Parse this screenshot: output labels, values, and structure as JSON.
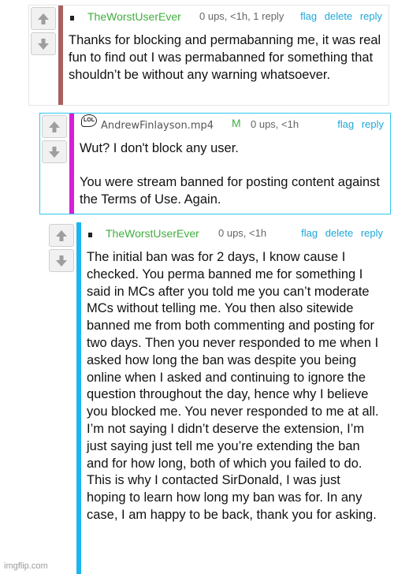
{
  "colors": {
    "bar_c1": "#a86060",
    "bar_c2": "#d81ed8",
    "bar_c3": "#1ab7ee",
    "border_c2": "#2ec7f0",
    "action": "#1ea7d6",
    "username": "#3fae3f"
  },
  "comments": [
    {
      "username": "TheWorstUserEver",
      "meta": "0 ups, <1h, 1 reply",
      "actions": [
        "flag",
        "delete",
        "reply"
      ],
      "text": [
        "Thanks for blocking and permabanning me, it was real fun to find out I was permabanned for something that shouldn’t be without any warning whatsoever."
      ]
    },
    {
      "avatar_text": "LOL",
      "username": "AndrewFinlayson.mp4",
      "badge": "M",
      "meta": "0 ups, <1h",
      "actions": [
        "flag",
        "reply"
      ],
      "text": [
        "Wut? I don't block any user.",
        "You were stream banned for posting content against the Terms of Use. Again."
      ]
    },
    {
      "username": "TheWorstUserEver",
      "meta": "0 ups, <1h",
      "actions": [
        "flag",
        "delete",
        "reply"
      ],
      "text": [
        "The initial ban was for 2 days, I know cause I checked. You perma banned me for something I said in MCs after you told me you can’t moderate MCs without telling me. You then also sitewide banned me from both commenting and posting for two days. Then you never responded to me when I asked how long the ban was despite you being online when I asked and continuing to ignore the question throughout the day, hence why I believe you blocked me. You never responded to me at all. I’m not saying I didn’t deserve the extension, I’m just saying just tell me you’re extending the ban and for how long, both of which you failed to do. This is why I contacted SirDonald, I was just hoping to learn how long my ban was for. In any case, I am happy to be back, thank you for asking."
      ]
    }
  ],
  "watermark": "imgflip.com"
}
